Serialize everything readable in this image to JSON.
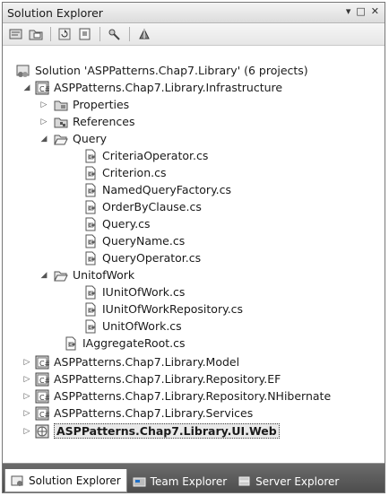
{
  "window": {
    "title": "Solution Explorer",
    "controls": {
      "dropdown": "▾",
      "maximize": "□",
      "close": "✕"
    }
  },
  "toolbar": {
    "buttons": [
      {
        "name": "properties-icon"
      },
      {
        "name": "show-all-files-icon"
      },
      {
        "name": "refresh-icon"
      },
      {
        "name": "view-code-icon"
      },
      {
        "name": "view-designer-icon"
      },
      {
        "name": "view-class-diagram-icon"
      }
    ]
  },
  "tree": {
    "solution": {
      "label": "Solution 'ASPPatterns.Chap7.Library' (6 projects)"
    },
    "infrastructure": {
      "label": "ASPPatterns.Chap7.Library.Infrastructure"
    },
    "properties": {
      "label": "Properties"
    },
    "references": {
      "label": "References"
    },
    "query": {
      "label": "Query"
    },
    "query_files": [
      "CriteriaOperator.cs",
      "Criterion.cs",
      "NamedQueryFactory.cs",
      "OrderByClause.cs",
      "Query.cs",
      "QueryName.cs",
      "QueryOperator.cs"
    ],
    "unitofwork": {
      "label": "UnitofWork"
    },
    "unitofwork_files": [
      "IUnitOfWork.cs",
      "IUnitOfWorkRepository.cs",
      "UnitOfWork.cs"
    ],
    "aggregate": {
      "label": "IAggregateRoot.cs"
    },
    "projects": [
      "ASPPatterns.Chap7.Library.Model",
      "ASPPatterns.Chap7.Library.Repository.EF",
      "ASPPatterns.Chap7.Library.Repository.NHibernate",
      "ASPPatterns.Chap7.Library.Services"
    ],
    "startup_project": {
      "label": "ASPPatterns.Chap7.Library.UI.Web"
    }
  },
  "tabs": [
    {
      "label": "Solution Explorer",
      "icon": "solution-explorer-icon",
      "active": true
    },
    {
      "label": "Team Explorer",
      "icon": "team-explorer-icon",
      "active": false
    },
    {
      "label": "Server Explorer",
      "icon": "server-explorer-icon",
      "active": false
    }
  ]
}
